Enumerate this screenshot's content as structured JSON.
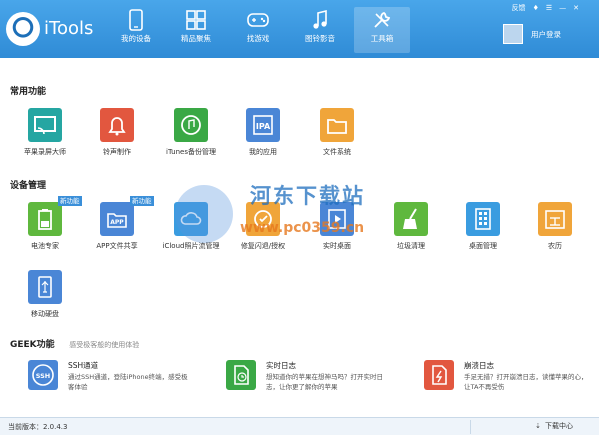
{
  "app": {
    "name": "iTools"
  },
  "nav": [
    {
      "label": "我的设备",
      "icon": "phone-icon"
    },
    {
      "label": "精品聚焦",
      "icon": "grid-icon"
    },
    {
      "label": "找游戏",
      "icon": "gamepad-icon"
    },
    {
      "label": "图铃影音",
      "icon": "music-icon"
    },
    {
      "label": "工具箱",
      "icon": "wrench-icon",
      "active": true
    }
  ],
  "top_links": {
    "feedback": "反馈",
    "user_login": "用户登录"
  },
  "sections": {
    "common": "常用功能",
    "device": "设备管理",
    "geek": "GEEK功能",
    "geek_sub": "感受极客般的使用体验"
  },
  "common_tools": [
    {
      "label": "苹果录屏大师",
      "icon": "screen-cast-icon",
      "color": "#25a6a2"
    },
    {
      "label": "铃声制作",
      "icon": "bell-icon",
      "color": "#e2573f"
    },
    {
      "label": "iTunes备份管理",
      "icon": "backup-icon",
      "color": "#3aa845"
    },
    {
      "label": "我的应用",
      "icon": "ipa-icon",
      "color": "#4a86d6"
    },
    {
      "label": "文件系统",
      "icon": "folder-icon",
      "color": "#f0a53a"
    }
  ],
  "device_tools": [
    {
      "label": "电池专家",
      "icon": "battery-icon",
      "color": "#5fb83e",
      "badge": "新功能"
    },
    {
      "label": "APP文件共享",
      "icon": "app-share-icon",
      "color": "#4a86d6",
      "badge": "新功能"
    },
    {
      "label": "iCloud照片流管理",
      "icon": "icloud-icon",
      "color": "#3a9ce0"
    },
    {
      "label": "修复闪退/授权",
      "icon": "repair-icon",
      "color": "#f0a53a"
    },
    {
      "label": "实时桌面",
      "icon": "play-icon",
      "color": "#4a86d6"
    },
    {
      "label": "垃圾清理",
      "icon": "broom-icon",
      "color": "#5fb83e"
    },
    {
      "label": "桌面管理",
      "icon": "desktop-grid-icon",
      "color": "#3a9ce0"
    },
    {
      "label": "农历",
      "icon": "calendar-icon",
      "color": "#f0a53a"
    },
    {
      "label": "移动硬盘",
      "icon": "usb-drive-icon",
      "color": "#4a86d6"
    }
  ],
  "geek_tools": [
    {
      "title": "SSH通道",
      "desc": "通过SSH通道，登陆iPhone终端，感受极客体验",
      "icon": "ssh-icon",
      "color": "#4a86d6"
    },
    {
      "title": "实时日志",
      "desc": "想知道你的苹果在想神马吗？打开实时日志，让你更了解你的苹果",
      "icon": "log-icon",
      "color": "#3aa845"
    },
    {
      "title": "崩溃日志",
      "desc": "手足无措？打开崩溃日志，读懂苹果的心，让TA不再受伤",
      "icon": "crash-log-icon",
      "color": "#e2573f"
    }
  ],
  "footer": {
    "version": "当前版本：2.0.4.3",
    "download_center": "下载中心"
  },
  "watermark": {
    "title": "河东下载站",
    "url": "www.pc0359.cn"
  },
  "colors": {
    "header": "#3c9ae0",
    "accent": "#3a8fd9"
  }
}
